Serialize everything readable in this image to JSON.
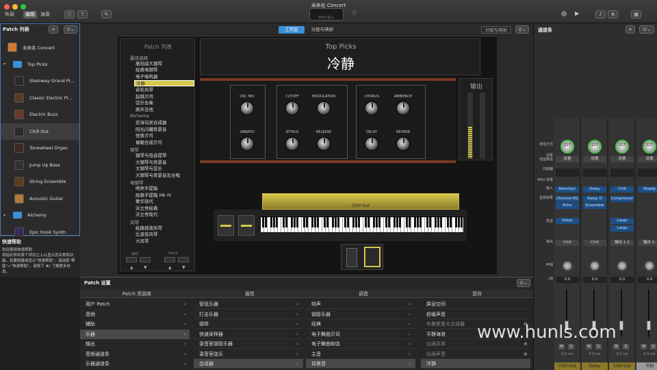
{
  "window": {
    "title": "未命名 Concert",
    "lcd_label": "MIDI 输入"
  },
  "modes": [
    "布局",
    "编辑",
    "演奏"
  ],
  "sidebar": {
    "title": "Patch 列表",
    "items": [
      {
        "label": "未命名 Concert",
        "type": "concert"
      },
      {
        "label": "Top Picks",
        "type": "folder"
      },
      {
        "label": "Steinway Grand Pi...",
        "type": "patch"
      },
      {
        "label": "Classic Electric Pi...",
        "type": "patch"
      },
      {
        "label": "Electric Buzz",
        "type": "patch"
      },
      {
        "label": "Chill Out",
        "type": "patch",
        "selected": true
      },
      {
        "label": "Tonewheel Organ",
        "type": "patch"
      },
      {
        "label": "Jump Up Bass",
        "type": "patch"
      },
      {
        "label": "String Ensemble",
        "type": "patch"
      },
      {
        "label": "Acoustic Guitar",
        "type": "patch"
      },
      {
        "label": "Alchemy",
        "type": "folder"
      },
      {
        "label": "Epic Hook Synth",
        "type": "patch"
      }
    ]
  },
  "quickhelp": {
    "title": "快速帮助",
    "body": "欢迎使用快速帮助\n将指针移到某个项目之上以显示其名称和功能。若要隐藏或显示\"快速帮助\"，请选取\"帮助\">\"快速帮助\"。请按下 ⌘/ 了解更多信息。"
  },
  "tabs": {
    "workspace": "工作区",
    "assign": "分配与映射",
    "right_assign": "分配与映射"
  },
  "patchlist_widget": {
    "title": "Patch 列表",
    "groups": [
      {
        "header": "最佳选择",
        "items": [
          "施坦威大钢琴",
          "经典电钢琴",
          "电子嗡鸣器",
          "冷静",
          "音轮风琴",
          "起跳贝司",
          "弦乐合奏",
          "原声吉他"
        ]
      },
      {
        "header": "Alchemy",
        "items": [
          "史诗勾状合成器",
          "阳光闪耀背景音",
          "怪兽贝司",
          "催眠合成贝司"
        ]
      },
      {
        "header": "钢琴",
        "items": [
          "钢琴与低音提琴",
          "大钢琴与背景音",
          "大钢琴与弦乐",
          "大钢琴与背景音及合唱"
        ]
      },
      {
        "header": "电钢琴",
        "items": [
          "明亮手提箱",
          "经典手提箱 Mk IV",
          "奢华现代",
          "沃立舍经典",
          "沃立舍现代"
        ]
      },
      {
        "header": "风琴",
        "items": [
          "经典摇滚风琴",
          "比波普风琴",
          "大风琴"
        ]
      }
    ],
    "selected": "冷静",
    "footer_left": "滚动",
    "footer_right": "Patch"
  },
  "title_display": {
    "small": "Top Picks",
    "big": "冷静"
  },
  "smart_controls": {
    "knobs": [
      "OSC MIX",
      "VIBRATO",
      "CUTOFF",
      "MODULATION",
      "ATTACK",
      "RELEASE",
      "CHORUS",
      "AMBIENCE",
      "DELAY",
      "REVERB"
    ],
    "output_label": "输出"
  },
  "keyboard": {
    "label": "Chill Out"
  },
  "settings": {
    "title": "Patch 设置",
    "library_title": "Patch 资源库",
    "library": [
      "用户 Patch",
      "音频",
      "辅助",
      "乐器",
      "输出",
      "音频通道条",
      "乐器通道条"
    ],
    "library_selected": "乐器",
    "col_headers": [
      "属性",
      "调音",
      "音符"
    ],
    "col1": [
      "管弦乐器",
      "打击乐器",
      "钢琴",
      "快速采样器",
      "录音室钢管乐器",
      "录音室弦乐",
      "合成器"
    ],
    "col2": [
      "特声",
      "钢管乐器",
      "经典",
      "电子舞曲贝司",
      "电子舞曲和弦",
      "主音",
      "背景音"
    ],
    "col3": [
      "屏息空间",
      "舒缓声音",
      "布鲁斯重大合成器",
      "平静海浪",
      "仙境风琴",
      "仙境声音",
      "冷静"
    ],
    "col3_dim": [
      2,
      4,
      5
    ]
  },
  "mixer": {
    "title": "通道条",
    "row_labels": [
      "表现方式",
      "设置\n增益降低",
      "均衡器",
      "MIDI 效果",
      "输入",
      "音频效果",
      "发送",
      "输出",
      "声相",
      "dB"
    ],
    "strips": [
      {
        "volume": "127",
        "setting": "设置",
        "input": "RetroSyn",
        "fx": [
          "Channel EQ",
          "Echo"
        ],
        "send": "Delay",
        "output": "Chill",
        "db": "0.0",
        "name": "Chill Out",
        "color": "#8a7a2a"
      },
      {
        "volume": "127",
        "setting": "设置",
        "input": "Delay",
        "fx": [
          "Delay D",
          "Ensemble"
        ],
        "send": "",
        "output": "Chill",
        "db": "0.0",
        "name": "Delay",
        "color": "#8a7a2a"
      },
      {
        "volume": "127",
        "setting": "设置",
        "input": "Chill",
        "fx": [
          "Compressor"
        ],
        "send": "Large",
        "send2": "Large",
        "output": "输出 1-2",
        "db": "0.0",
        "name": "Chill Out",
        "color": "#8a7a2a"
      },
      {
        "volume": "127",
        "setting": "设置",
        "input": "Klopfg",
        "fx": [],
        "send": "",
        "output": "输出 1-",
        "db": "0.0",
        "name": "节拍",
        "color": "#9a9a9a"
      }
    ],
    "delay_readout": "0.0 ms"
  },
  "watermark": "www.hunls.com",
  "colors": {
    "accent": "#3d8fd6",
    "keyboard_bar": "#b8a33a",
    "selection_yellow": "#d8c84a"
  }
}
